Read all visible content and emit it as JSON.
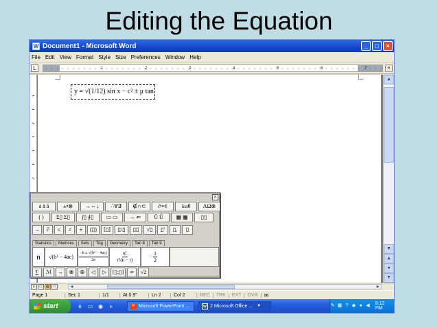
{
  "slide": {
    "title": "Editing the Equation"
  },
  "window": {
    "title": "Document1 - Microsoft Word",
    "app_icon": "W",
    "controls": {
      "minimize": "_",
      "maximize": "□",
      "close": "×"
    }
  },
  "menubar": {
    "items": [
      "File",
      "Edit",
      "View",
      "Format",
      "Style",
      "Size",
      "Preferences",
      "Window",
      "Help"
    ]
  },
  "ruler": {
    "tab_selector": "L",
    "numbers": [
      "1",
      "2",
      "3",
      "4",
      "5",
      "6",
      "7"
    ],
    "close_label": "×"
  },
  "equation": {
    "text": "y = √(1/12) sin x − c² ± μ tan x"
  },
  "palette": {
    "close_label": "×",
    "row1": [
      "≤≠≈",
      "ȧ ä ā",
      "±•⊗",
      "→⇔↓",
      "∴∀∃",
      "∉∩⊂",
      "∂∞ℓ",
      "λωθ",
      "ΛΩ⊗"
    ],
    "row2": [
      "[ ]",
      "( )",
      "Σ▯ Σ▯",
      "∫▯ ∮▯",
      "▭ ▭",
      "→ ⇐",
      "Ū Ů",
      "▦ ▦",
      "▯▯"
    ],
    "row3": [
      "→",
      "∂",
      "≤",
      "≠",
      "±",
      "(▯)",
      "[▯]",
      "▯/▯",
      "▯▯",
      "√▯",
      "▯'",
      "▯,",
      "▯"
    ],
    "tabs": [
      "Statistics",
      "Matrices",
      "Sets",
      "Trig",
      "Geometry",
      "Tab 8",
      "Tab 9"
    ],
    "template_cells": {
      "first": "n",
      "quadratic": "√(b² − 4ac)",
      "solution_num": "−b ± √(b² − 4ac)",
      "solution_den": "2a",
      "perm_num": "n!",
      "perm_den": "r!(n − r)",
      "half_num": "1",
      "half_den": "2"
    },
    "row5": [
      "∑",
      "ℳ",
      "→",
      "⊗",
      "⊕",
      "◁",
      "▷",
      "[▯;▯]",
      "∞",
      "√2"
    ]
  },
  "hscroll": {
    "view_buttons": [
      "≡",
      "▭",
      "▤",
      "□"
    ]
  },
  "status": {
    "page": "Page 1",
    "sec": "Sec 1",
    "pages": "1/1",
    "at": "At 0.9\"",
    "ln": "Ln 2",
    "col": "Col 2",
    "rec": "REC",
    "trk": "TRK",
    "ext": "EXT",
    "ovr": "OVR"
  },
  "taskbar": {
    "start": "start",
    "quick_launch_more": "»",
    "items": [
      {
        "icon": "P",
        "label": "Microsoft PowerPoint ..."
      },
      {
        "icon": "W",
        "label": "2 Microsoft Office ..."
      }
    ],
    "clock": "8:12 PM"
  }
}
